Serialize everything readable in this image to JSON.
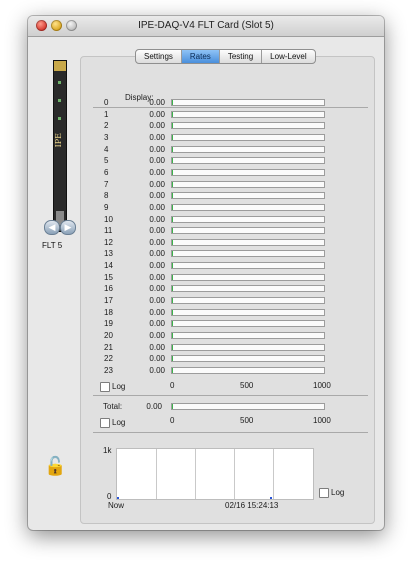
{
  "window": {
    "title": "IPE-DAQ-V4 FLT Card (Slot 5)"
  },
  "card": {
    "slot_label": "FLT 5",
    "card_text": "IPE"
  },
  "tabs": [
    {
      "label": "Settings",
      "active": false
    },
    {
      "label": "Rates",
      "active": true
    },
    {
      "label": "Testing",
      "active": false
    },
    {
      "label": "Low-Level",
      "active": false
    }
  ],
  "rates": {
    "display_label": "Display:",
    "channels": [
      {
        "index": "0",
        "value": "0.00",
        "fraction": 0
      },
      {
        "index": "1",
        "value": "0.00",
        "fraction": 0
      },
      {
        "index": "2",
        "value": "0.00",
        "fraction": 0
      },
      {
        "index": "3",
        "value": "0.00",
        "fraction": 0
      },
      {
        "index": "4",
        "value": "0.00",
        "fraction": 0
      },
      {
        "index": "5",
        "value": "0.00",
        "fraction": 0
      },
      {
        "index": "6",
        "value": "0.00",
        "fraction": 0
      },
      {
        "index": "7",
        "value": "0.00",
        "fraction": 0
      },
      {
        "index": "8",
        "value": "0.00",
        "fraction": 0
      },
      {
        "index": "9",
        "value": "0.00",
        "fraction": 0
      },
      {
        "index": "10",
        "value": "0.00",
        "fraction": 0
      },
      {
        "index": "11",
        "value": "0.00",
        "fraction": 0
      },
      {
        "index": "12",
        "value": "0.00",
        "fraction": 0
      },
      {
        "index": "13",
        "value": "0.00",
        "fraction": 0
      },
      {
        "index": "14",
        "value": "0.00",
        "fraction": 0
      },
      {
        "index": "15",
        "value": "0.00",
        "fraction": 0
      },
      {
        "index": "16",
        "value": "0.00",
        "fraction": 0
      },
      {
        "index": "17",
        "value": "0.00",
        "fraction": 0
      },
      {
        "index": "18",
        "value": "0.00",
        "fraction": 0
      },
      {
        "index": "19",
        "value": "0.00",
        "fraction": 0
      },
      {
        "index": "20",
        "value": "0.00",
        "fraction": 0
      },
      {
        "index": "21",
        "value": "0.00",
        "fraction": 0
      },
      {
        "index": "22",
        "value": "0.00",
        "fraction": 0
      },
      {
        "index": "23",
        "value": "0.00",
        "fraction": 0
      }
    ],
    "log_label": "Log",
    "scale_ticks": [
      "0",
      "500",
      "1000"
    ],
    "total": {
      "label": "Total:",
      "value": "0.00",
      "fraction": 0
    },
    "total_log_label": "Log",
    "total_scale_ticks": [
      "0",
      "500",
      "1000"
    ]
  },
  "chart_data": {
    "type": "scatter",
    "y_ticks": [
      "0",
      "1k"
    ],
    "ylim": [
      0,
      1000
    ],
    "x_label_left": "Now",
    "x_label_right": "02/16 15:24:13",
    "points": [
      {
        "x": 0,
        "y": 0
      },
      {
        "x": 0.79,
        "y": 0
      }
    ],
    "grid": true,
    "log_label": "Log"
  },
  "colors": {
    "bar_fill": "#3bb34a",
    "tab_active": "#4a8fdc",
    "plot_points": "#2a55d6"
  }
}
